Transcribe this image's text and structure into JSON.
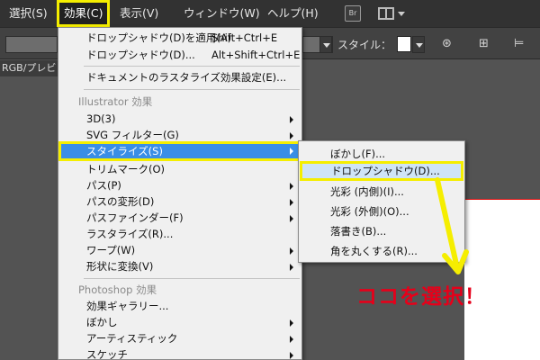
{
  "menubar": {
    "items": [
      {
        "label": "選択(S)"
      },
      {
        "label": "効果(C)"
      },
      {
        "label": "表示(V)"
      },
      {
        "label": "ウィンドウ(W)"
      },
      {
        "label": "ヘルプ(H)"
      }
    ],
    "br_icon": "Br"
  },
  "controlbar": {
    "style_label": "スタイル："
  },
  "document": {
    "tab_label": "RGB/プレビュー"
  },
  "menu": {
    "items": [
      {
        "label": "ドロップシャドウ(D)を適用(A)",
        "shortcut": "Shift+Ctrl+E"
      },
      {
        "label": "ドロップシャドウ(D)...",
        "shortcut": "Alt+Shift+Ctrl+E"
      },
      {
        "label": "ドキュメントのラスタライズ効果設定(E)..."
      },
      {
        "label": "Illustrator 効果"
      },
      {
        "label": "3D(3)"
      },
      {
        "label": "SVG フィルター(G)"
      },
      {
        "label": "スタイライズ(S)"
      },
      {
        "label": "トリムマーク(O)"
      },
      {
        "label": "パス(P)"
      },
      {
        "label": "パスの変形(D)"
      },
      {
        "label": "パスファインダー(F)"
      },
      {
        "label": "ラスタライズ(R)..."
      },
      {
        "label": "ワープ(W)"
      },
      {
        "label": "形状に変換(V)"
      },
      {
        "label": "Photoshop 効果"
      },
      {
        "label": "効果ギャラリー..."
      },
      {
        "label": "ぼかし"
      },
      {
        "label": "アーティスティック"
      },
      {
        "label": "スケッチ"
      }
    ]
  },
  "submenu": {
    "items": [
      {
        "label": "ぼかし(F)..."
      },
      {
        "label": "ドロップシャドウ(D)..."
      },
      {
        "label": "光彩 (内側)(I)..."
      },
      {
        "label": "光彩 (外側)(O)..."
      },
      {
        "label": "落書き(B)..."
      },
      {
        "label": "角を丸くする(R)..."
      }
    ]
  },
  "annotation": {
    "callout": "ココを選択！"
  },
  "colors": {
    "highlight_outline": "#f5ee00",
    "menu_highlight": "#3a8ee6",
    "callout": "#e6001a"
  },
  "icons": [
    "bridge-icon",
    "workspace-icon",
    "recolor-icon",
    "align-icon",
    "transform-icon",
    "submenu-arrow-icon",
    "annotation-arrow-icon"
  ]
}
